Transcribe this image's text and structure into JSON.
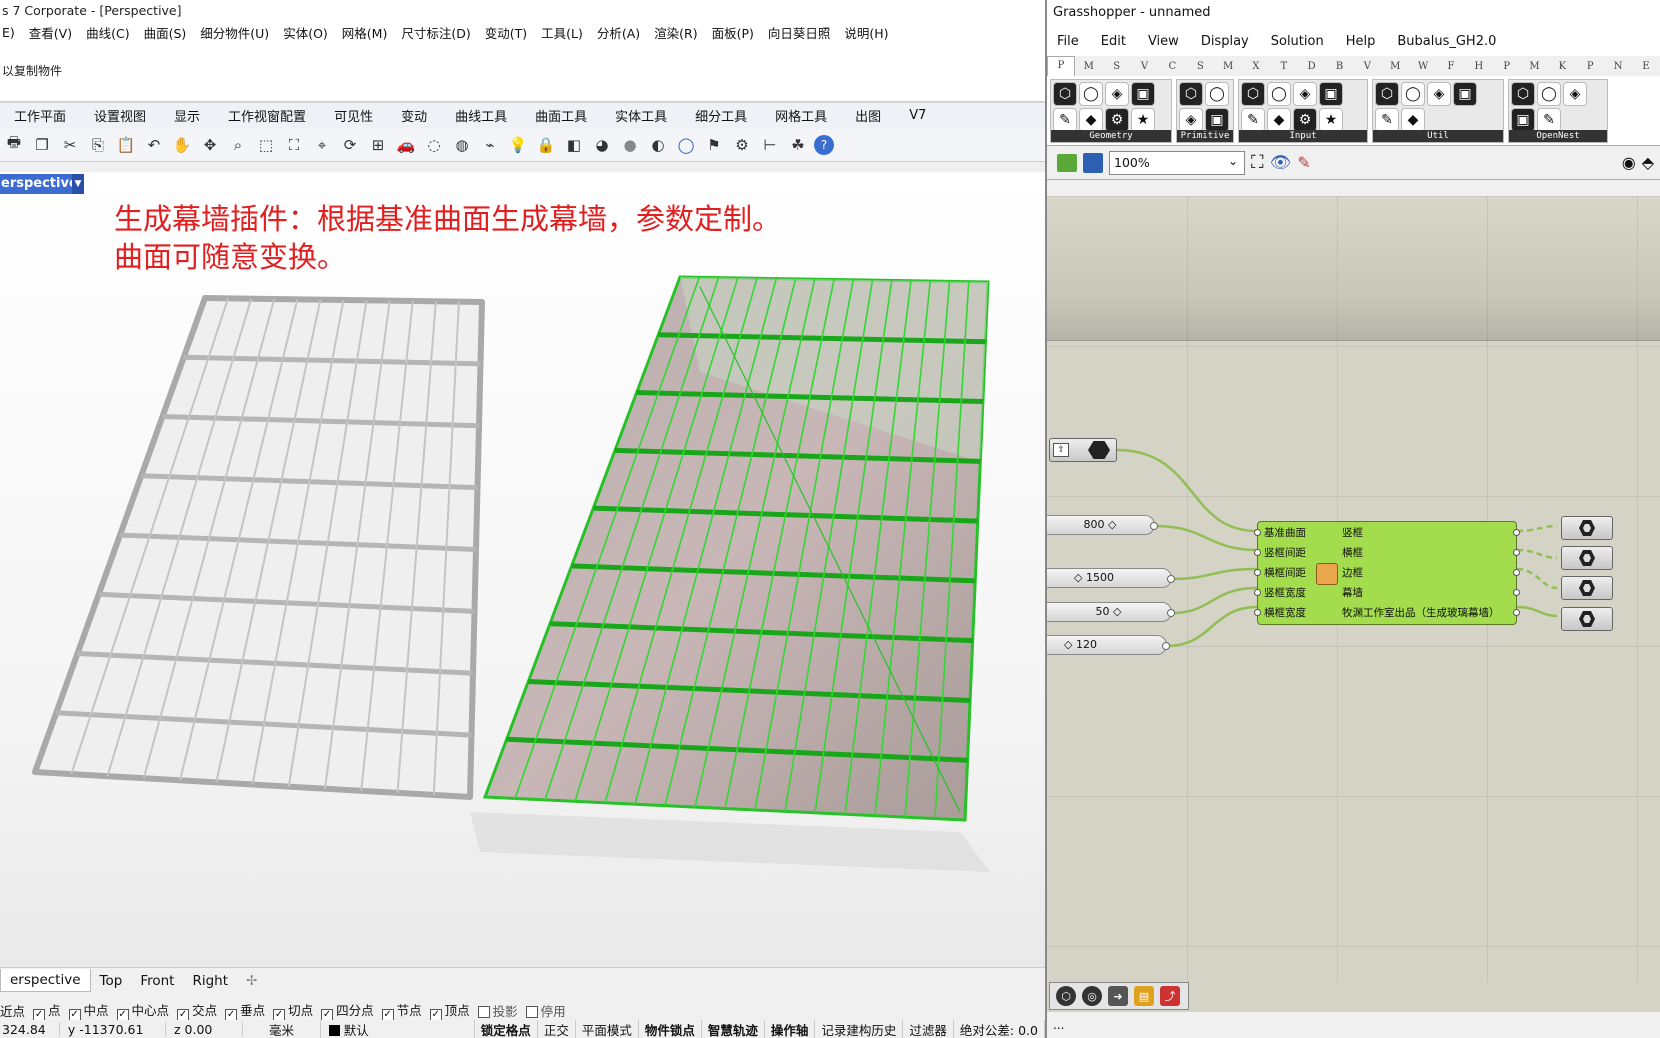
{
  "rhino": {
    "title": "s 7 Corporate - [Perspective]",
    "menu": [
      "E)",
      "查看(V)",
      "曲线(C)",
      "曲面(S)",
      "细分物件(U)",
      "实体(O)",
      "网格(M)",
      "尺寸标注(D)",
      "变动(T)",
      "工具(L)",
      "分析(A)",
      "渲染(R)",
      "面板(P)",
      "向日葵日照",
      "说明(H)"
    ],
    "command_history": "以复制物件",
    "toolbar_tabs": [
      "工作平面",
      "设置视图",
      "显示",
      "工作视窗配置",
      "可见性",
      "变动",
      "曲线工具",
      "曲面工具",
      "实体工具",
      "细分工具",
      "网格工具",
      "出图",
      "V7"
    ],
    "toolbar_icons": [
      "print-icon",
      "copy-icon",
      "cut-icon",
      "copy2-icon",
      "paste-icon",
      "undo-icon",
      "pan-icon",
      "rotate-view-icon",
      "zoom-icon",
      "zoom-window-icon",
      "zoom-extents-icon",
      "zoom-selected-icon",
      "rotate-icon",
      "grid-icon",
      "car-icon",
      "hide-icon",
      "ghost-icon",
      "snap-icon",
      "light-icon",
      "lock-icon",
      "layer-icon",
      "color-wheel-icon",
      "sphere-icon",
      "render-icon",
      "globe-icon",
      "flag-icon",
      "gears-icon",
      "dimension-icon",
      "grasshopper-icon",
      "help-icon"
    ],
    "viewport_title": "erspective",
    "annotation_line1": "生成幕墙插件：根据基准曲面生成幕墙，参数定制。",
    "annotation_line2": "曲面可随意变换。",
    "viewport_tabs": [
      "erspective",
      "Top",
      "Front",
      "Right"
    ],
    "osnaps": [
      {
        "label": "近点",
        "checked": false,
        "bare": true
      },
      {
        "label": "点",
        "checked": true
      },
      {
        "label": "中点",
        "checked": true
      },
      {
        "label": "中心点",
        "checked": true
      },
      {
        "label": "交点",
        "checked": true
      },
      {
        "label": "垂点",
        "checked": true
      },
      {
        "label": "切点",
        "checked": true
      },
      {
        "label": "四分点",
        "checked": true
      },
      {
        "label": "节点",
        "checked": true
      },
      {
        "label": "顶点",
        "checked": true
      },
      {
        "label": "投影",
        "checked": false
      },
      {
        "label": "停用",
        "checked": false
      }
    ],
    "status": {
      "x": "324.84",
      "y": "y -11370.61",
      "z": "z 0.00",
      "units": "毫米",
      "layer": "默认",
      "toggles": [
        "锁定格点",
        "正交",
        "平面模式",
        "物件锁点",
        "智慧轨迹",
        "操作轴",
        "记录建构历史",
        "过滤器",
        "绝对公差: 0.0"
      ],
      "toggles_bold": [
        "锁定格点",
        "物件锁点",
        "智慧轨迹",
        "操作轴"
      ]
    }
  },
  "grasshopper": {
    "title": "Grasshopper - unnamed",
    "menu": [
      "File",
      "Edit",
      "View",
      "Display",
      "Solution",
      "Help",
      "Bubalus_GH2.0"
    ],
    "tabs": [
      "P",
      "M",
      "S",
      "V",
      "C",
      "S",
      "M",
      "X",
      "T",
      "D",
      "B",
      "V",
      "M",
      "W",
      "F",
      "H",
      "P",
      "M",
      "K",
      "P",
      "N",
      "E"
    ],
    "panels": [
      {
        "label": "Geometry",
        "icons": 8
      },
      {
        "label": "Primitive",
        "icons": 4
      },
      {
        "label": "Input",
        "icons": 8
      },
      {
        "label": "Util",
        "icons": 6
      },
      {
        "label": "OpenNest",
        "icons": 5
      }
    ],
    "zoom": "100%",
    "sliders": [
      {
        "value": "800 ◇"
      },
      {
        "value": "◇ 1500"
      },
      {
        "value": "50 ◇"
      },
      {
        "value": "◇ 120"
      }
    ],
    "component": {
      "inputs": [
        "基准曲面",
        "竖框间距",
        "横框间距",
        "竖框宽度",
        "横框宽度"
      ],
      "outputs": [
        "竖框",
        "横框",
        "边框",
        "幕墙",
        "牧渊工作室出品（生成玻璃幕墙）"
      ]
    },
    "status_text": "..."
  },
  "colors": {
    "annotation": "#e02020",
    "gh_component": "#a3dc4d",
    "wire": "#8fbf55",
    "selected_geometry": "#27c227"
  }
}
